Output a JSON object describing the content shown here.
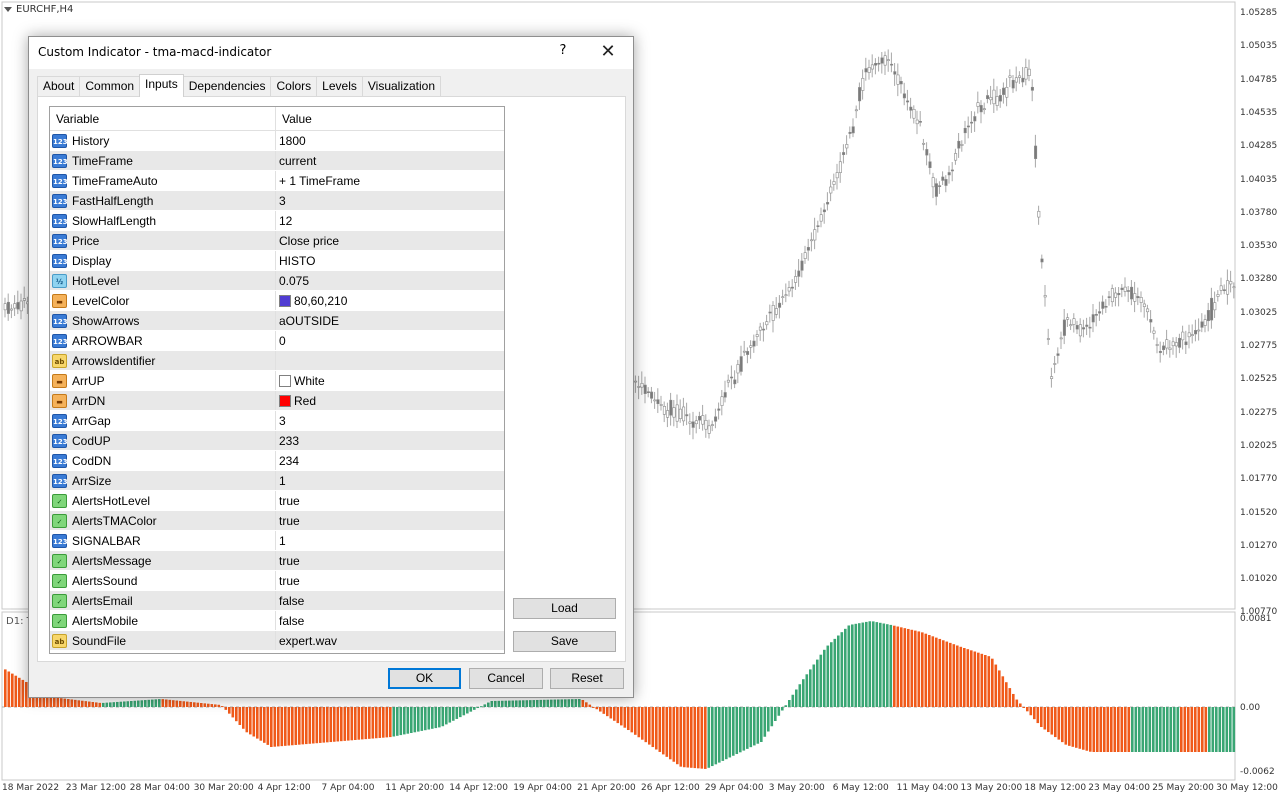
{
  "chart": {
    "symbol": "EURCHF,H4",
    "subwindow_label": "D1: T",
    "price_axis": [
      "1.05285",
      "1.05035",
      "1.04785",
      "1.04535",
      "1.04285",
      "1.04035",
      "1.03780",
      "1.03530",
      "1.03280",
      "1.03025",
      "1.02775",
      "1.02525",
      "1.02275",
      "1.02025",
      "1.01770",
      "1.01520",
      "1.01270",
      "1.01020",
      "1.00770"
    ],
    "indicator_axis": [
      "0.0081",
      "0.00",
      "-0.0062"
    ],
    "date_axis": [
      "18 Mar 2022",
      "23 Mar 12:00",
      "28 Mar 04:00",
      "30 Mar 20:00",
      "4 Apr 12:00",
      "7 Apr 04:00",
      "11 Apr 20:00",
      "14 Apr 12:00",
      "19 Apr 04:00",
      "21 Apr 20:00",
      "26 Apr 12:00",
      "29 Apr 04:00",
      "3 May 20:00",
      "6 May 12:00",
      "11 May 04:00",
      "13 May 20:00",
      "18 May 12:00",
      "23 May 04:00",
      "25 May 20:00",
      "30 May 12:00"
    ],
    "colors": {
      "up_histo": "#3aa674",
      "down_histo": "#f05a1a",
      "candles": "#808080"
    }
  },
  "dialog": {
    "title": "Custom Indicator - tma-macd-indicator",
    "help_label": "?",
    "close_label": "✕",
    "tabs": [
      "About",
      "Common",
      "Inputs",
      "Dependencies",
      "Colors",
      "Levels",
      "Visualization"
    ],
    "active_tab": "Inputs",
    "columns": {
      "variable": "Variable",
      "value": "Value"
    },
    "params": [
      {
        "type": "int",
        "icon": "123",
        "name": "History",
        "value": "1800"
      },
      {
        "type": "int",
        "icon": "123",
        "name": "TimeFrame",
        "value": "current"
      },
      {
        "type": "int",
        "icon": "123",
        "name": "TimeFrameAuto",
        "value": "+ 1 TimeFrame"
      },
      {
        "type": "int",
        "icon": "123",
        "name": "FastHalfLength",
        "value": "3"
      },
      {
        "type": "int",
        "icon": "123",
        "name": "SlowHalfLength",
        "value": "12"
      },
      {
        "type": "int",
        "icon": "123",
        "name": "Price",
        "value": "Close price"
      },
      {
        "type": "int",
        "icon": "123",
        "name": "Display",
        "value": "HISTO"
      },
      {
        "type": "dbl",
        "icon": "½",
        "name": "HotLevel",
        "value": "0.075"
      },
      {
        "type": "color",
        "icon": "▬",
        "name": "LevelColor",
        "value": "80,60,210",
        "swatch": "#503cd2"
      },
      {
        "type": "int",
        "icon": "123",
        "name": "ShowArrows",
        "value": "aOUTSIDE"
      },
      {
        "type": "int",
        "icon": "123",
        "name": "ARROWBAR",
        "value": "0"
      },
      {
        "type": "str",
        "icon": "ab",
        "name": "ArrowsIdentifier",
        "value": ""
      },
      {
        "type": "color",
        "icon": "▬",
        "name": "ArrUP",
        "value": "White",
        "swatch": "#ffffff"
      },
      {
        "type": "color",
        "icon": "▬",
        "name": "ArrDN",
        "value": "Red",
        "swatch": "#ff0000"
      },
      {
        "type": "int",
        "icon": "123",
        "name": "ArrGap",
        "value": "3"
      },
      {
        "type": "int",
        "icon": "123",
        "name": "CodUP",
        "value": "233"
      },
      {
        "type": "int",
        "icon": "123",
        "name": "CodDN",
        "value": "234"
      },
      {
        "type": "int",
        "icon": "123",
        "name": "ArrSize",
        "value": "1"
      },
      {
        "type": "bool",
        "icon": "✓",
        "name": "AlertsHotLevel",
        "value": "true"
      },
      {
        "type": "bool",
        "icon": "✓",
        "name": "AlertsTMAColor",
        "value": "true"
      },
      {
        "type": "int",
        "icon": "123",
        "name": "SIGNALBAR",
        "value": "1"
      },
      {
        "type": "bool",
        "icon": "✓",
        "name": "AlertsMessage",
        "value": "true"
      },
      {
        "type": "bool",
        "icon": "✓",
        "name": "AlertsSound",
        "value": "true"
      },
      {
        "type": "bool",
        "icon": "✓",
        "name": "AlertsEmail",
        "value": "false"
      },
      {
        "type": "bool",
        "icon": "✓",
        "name": "AlertsMobile",
        "value": "false"
      },
      {
        "type": "str",
        "icon": "ab",
        "name": "SoundFile",
        "value": "expert.wav"
      }
    ],
    "buttons": {
      "load": "Load",
      "save": "Save",
      "ok": "OK",
      "cancel": "Cancel",
      "reset": "Reset"
    }
  }
}
